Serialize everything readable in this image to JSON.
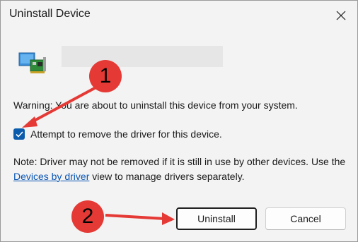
{
  "window": {
    "title": "Uninstall Device",
    "close_icon": "close-icon"
  },
  "device": {
    "icon": "network-adapter-icon",
    "name": ""
  },
  "warning_text": "Warning: You are about to uninstall this device from your system.",
  "checkbox": {
    "label": "Attempt to remove the driver for this device.",
    "checked": true
  },
  "note": {
    "prefix": "Note: Driver may not be removed if it is still in use by other devices. Use the ",
    "link": "Devices by driver",
    "suffix": " view to manage drivers separately."
  },
  "buttons": {
    "uninstall": "Uninstall",
    "cancel": "Cancel"
  },
  "annotations": {
    "one": "1",
    "two": "2",
    "color": "#e53935"
  }
}
